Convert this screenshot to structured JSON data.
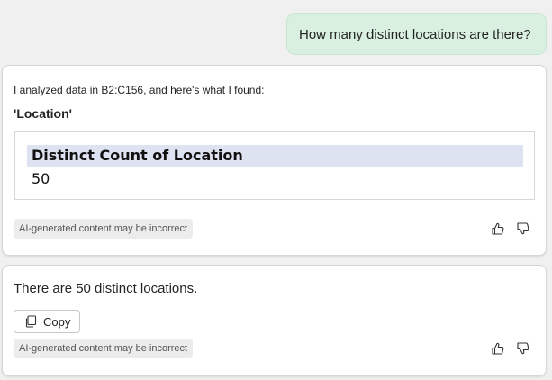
{
  "user_message": {
    "text": "How many distinct locations are there?"
  },
  "response_1": {
    "intro": "I analyzed data in B2:C156, and here's what I found:",
    "label": "'Location'",
    "table": {
      "header": "Distinct Count of Location",
      "value": "50"
    },
    "disclaimer": "AI-generated content may be incorrect",
    "icons": [
      "thumbs-up-icon",
      "thumbs-down-icon"
    ]
  },
  "response_2": {
    "answer": "There are 50 distinct locations.",
    "copy_label": "Copy",
    "disclaimer": "AI-generated content may be incorrect",
    "icons": [
      "copy-icon",
      "thumbs-up-icon",
      "thumbs-down-icon"
    ]
  },
  "colors": {
    "user_bubble": "#d9f0e0",
    "table_header": "#dde3f0",
    "table_header_border": "#4a66a0",
    "background": "#f0f0f0"
  }
}
